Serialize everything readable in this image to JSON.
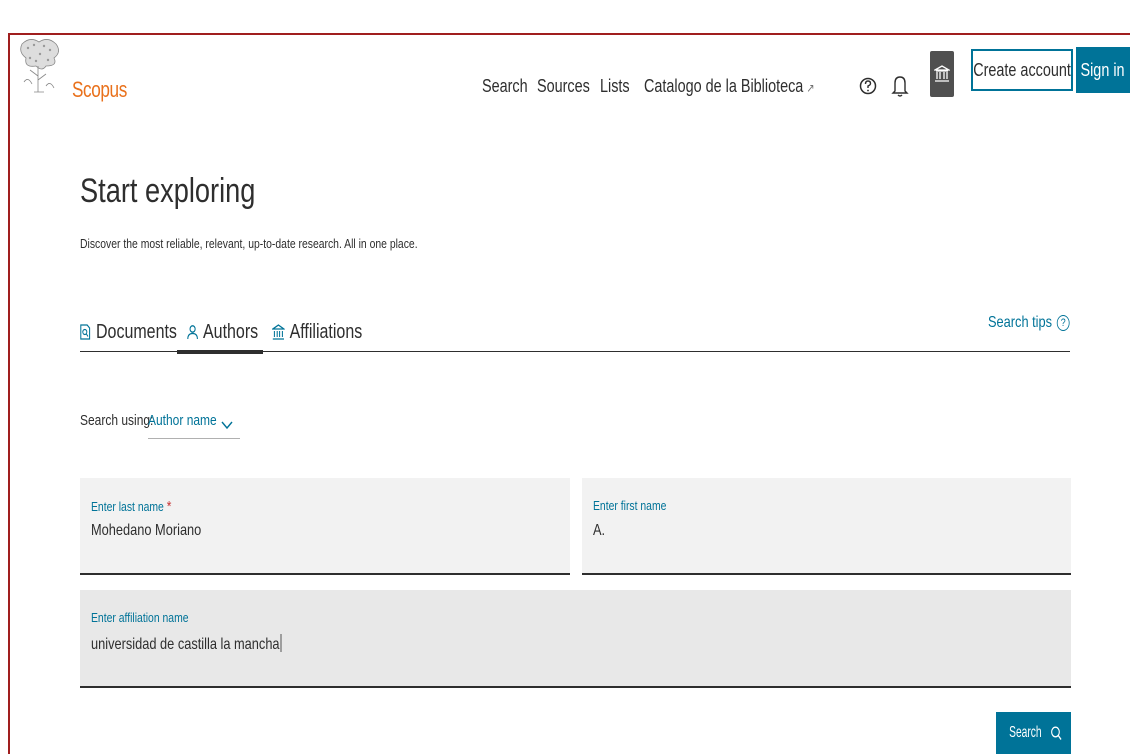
{
  "header": {
    "brand": "Scopus",
    "nav": [
      {
        "label": "Search"
      },
      {
        "label": "Sources"
      },
      {
        "label": "Lists"
      },
      {
        "label": "Catalogo de la Biblioteca",
        "external_mark": "↗"
      }
    ],
    "create_account": "Create account",
    "sign_in": "Sign in"
  },
  "main": {
    "title": "Start exploring",
    "subtitle": "Discover the most reliable, relevant, up-to-date research. All in one place.",
    "tabs": [
      {
        "label": "Documents",
        "icon": "document-search-icon",
        "active": false
      },
      {
        "label": "Authors",
        "icon": "person-icon",
        "active": true
      },
      {
        "label": "Affiliations",
        "icon": "institution-icon",
        "active": false
      }
    ],
    "search_tips": "Search tips",
    "search_tips_icon": "?",
    "search_using_label": "Search using:",
    "search_using_value": "Author name",
    "fields": {
      "last_name": {
        "label": "Enter last name",
        "required_mark": "*",
        "value": "Mohedano Moriano"
      },
      "first_name": {
        "label": "Enter first name",
        "value": "A."
      },
      "affiliation": {
        "label": "Enter affiliation name",
        "value": "universidad de castilla la mancha"
      }
    },
    "search_button": "Search"
  },
  "colors": {
    "brand_orange": "#e9711c",
    "accent_blue": "#007398",
    "text": "#2e2e2e",
    "frame_red": "#a01e1e"
  }
}
